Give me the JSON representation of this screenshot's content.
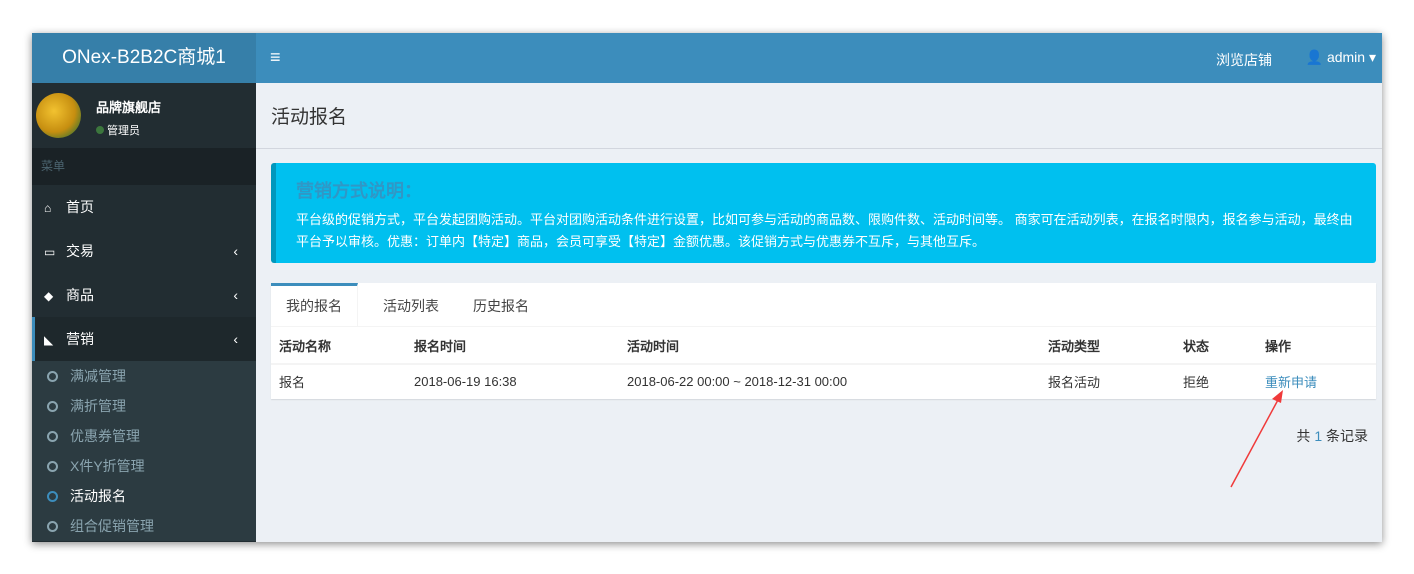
{
  "app": {
    "title": "ONex-B2B2C商城1"
  },
  "header": {
    "menu_icon": "≡",
    "shop_link": "浏览店铺",
    "user": "admin"
  },
  "sidebar": {
    "user_name": "品牌旗舰店",
    "user_status": "管理员",
    "menu_header": "菜单",
    "items": [
      {
        "label": "首页",
        "icon": "home-icon"
      },
      {
        "label": "交易",
        "icon": "card-icon"
      },
      {
        "label": "商品",
        "icon": "cube-icon"
      },
      {
        "label": "营销",
        "icon": "tag-icon"
      }
    ],
    "subitems": [
      {
        "label": "满减管理"
      },
      {
        "label": "满折管理"
      },
      {
        "label": "优惠券管理"
      },
      {
        "label": "X件Y折管理"
      },
      {
        "label": "活动报名"
      },
      {
        "label": "组合促销管理"
      }
    ]
  },
  "page": {
    "title": "活动报名"
  },
  "callout": {
    "title": "营销方式说明：",
    "text": "平台级的促销方式，平台发起团购活动。平台对团购活动条件进行设置，比如可参与活动的商品数、限购件数、活动时间等。 商家可在活动列表，在报名时限内，报名参与活动，最终由平台予以审核。优惠：订单内【特定】商品，会员可享受【特定】金额优惠。该促销方式与优惠券不互斥，与其他互斥。"
  },
  "tabs": [
    {
      "label": "我的报名"
    },
    {
      "label": "活动列表"
    },
    {
      "label": "历史报名"
    }
  ],
  "table": {
    "headers": [
      "活动名称",
      "报名时间",
      "活动时间",
      "活动类型",
      "状态",
      "操作"
    ],
    "rows": [
      {
        "name": "报名",
        "signup_time": "2018-06-19 16:38",
        "activity_time": "2018-06-22 00:00 ~ 2018-12-31 00:00",
        "type": "报名活动",
        "status": "拒绝",
        "action": "重新申请"
      }
    ]
  },
  "pagination": {
    "prefix": "共",
    "count": "1",
    "suffix": "条记录"
  }
}
